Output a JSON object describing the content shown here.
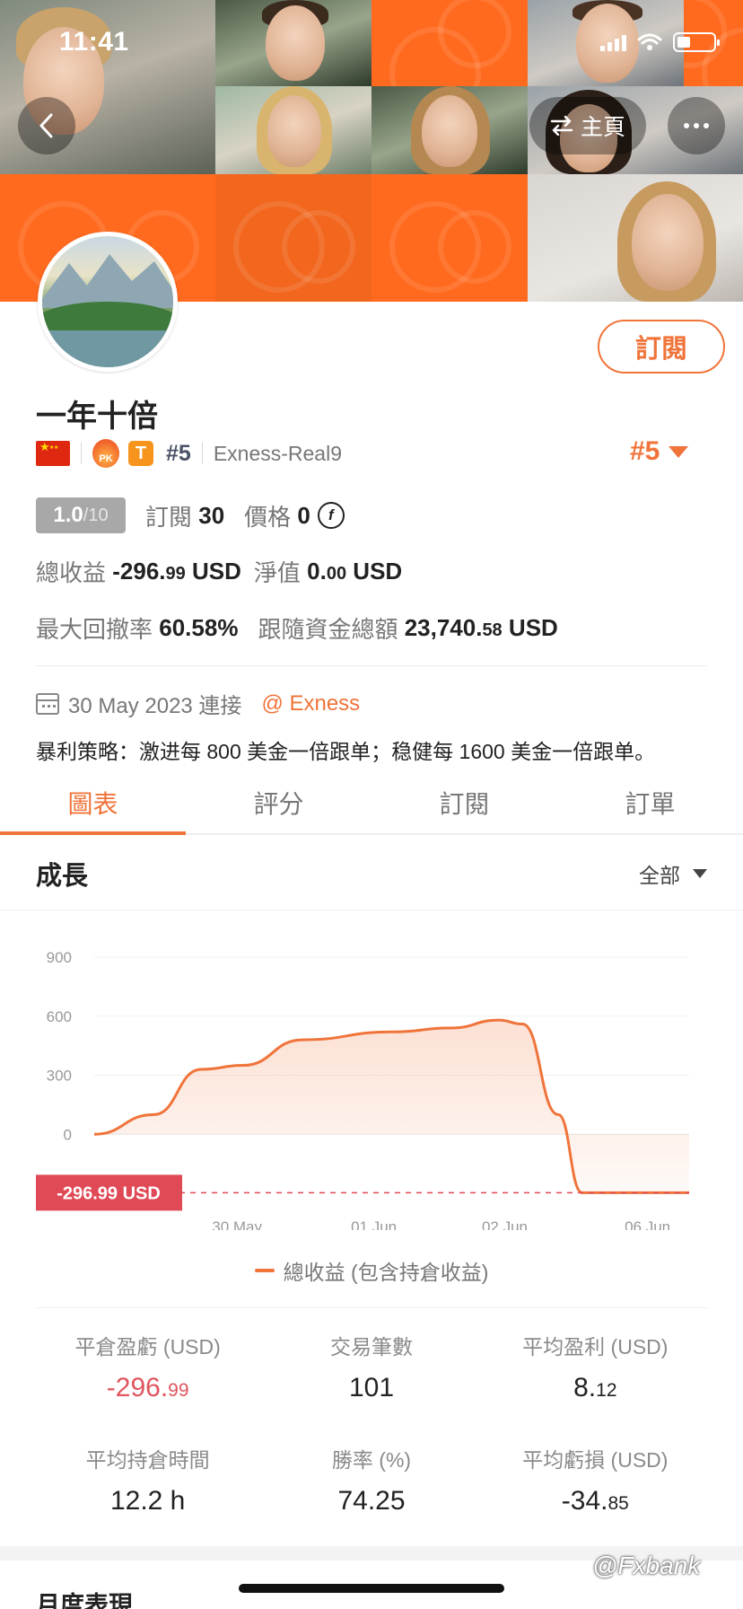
{
  "status_bar": {
    "time": "11:41"
  },
  "nav": {
    "home_label": "主頁"
  },
  "profile": {
    "subscribe_label": "訂閱",
    "name": "一年十倍",
    "rank_small": "#5",
    "server": "Exness-Real9",
    "rank_big": "#5",
    "score": "1.0",
    "score_denominator": "/10",
    "subscriptions_label": "訂閱",
    "subscriptions_value": "30",
    "price_label": "價格",
    "price_value": "0",
    "coin_symbol": "f",
    "total_profit_label": "總收益",
    "total_profit_main": "-296.",
    "total_profit_decimal": "99",
    "total_profit_unit": " USD",
    "equity_label": "淨值",
    "equity_main": "0.",
    "equity_decimal": "00",
    "equity_unit": " USD",
    "max_drawdown_label": "最大回撤率",
    "max_drawdown_value": "60.58%",
    "follow_funds_label": "跟隨資金總額",
    "follow_funds_main": "23,740.",
    "follow_funds_decimal": "58",
    "follow_funds_unit": " USD",
    "connected_date": "30 May 2023 連接",
    "broker": "@ Exness",
    "description": "暴利策略：激进每 800 美金一倍跟单；稳健每 1600 美金一倍跟单。"
  },
  "tabs": [
    {
      "label": "圖表",
      "active": true
    },
    {
      "label": "評分",
      "active": false
    },
    {
      "label": "訂閱",
      "active": false
    },
    {
      "label": "訂單",
      "active": false
    }
  ],
  "growth": {
    "title": "成長",
    "filter_label": "全部"
  },
  "chart_data": {
    "type": "area",
    "y_ticks": [
      "900",
      "600",
      "300",
      "0"
    ],
    "x_ticks": [
      "30 May",
      "01 Jun",
      "02 Jun",
      "06 Jun"
    ],
    "ylim": [
      -350,
      900
    ],
    "x": [
      0,
      0.1,
      0.18,
      0.25,
      0.35,
      0.5,
      0.6,
      0.68,
      0.72,
      0.78,
      0.82,
      0.9,
      1.0
    ],
    "values": [
      0,
      100,
      330,
      350,
      480,
      520,
      540,
      580,
      560,
      100,
      -296.99,
      -296.99,
      -296.99
    ],
    "series": [
      {
        "name": "總收益 (包含持倉收益)",
        "color": "#f0743a"
      }
    ],
    "current_value_label": "-296.99 USD",
    "current_value_color": "#e04a57"
  },
  "legend_label": "總收益 (包含持倉收益)",
  "stats": {
    "closed_pnl_label": "平倉盈虧 (USD)",
    "closed_pnl_main": "-296.",
    "closed_pnl_decimal": "99",
    "trades_label": "交易筆數",
    "trades_value": "101",
    "avg_profit_label": "平均盈利 (USD)",
    "avg_profit_main": "8.",
    "avg_profit_decimal": "12",
    "avg_hold_label": "平均持倉時間",
    "avg_hold_value": "12.2 h",
    "win_rate_label": "勝率 (%)",
    "win_rate_value": "74.25",
    "avg_loss_label": "平均虧損 (USD)",
    "avg_loss_main": "-34.",
    "avg_loss_decimal": "85"
  },
  "monthly_title": "月度表現",
  "watermark": "@Fxbank",
  "colors": {
    "accent": "#f0743a",
    "negative": "#e0555e",
    "banner_orange": "#ff6a1f"
  }
}
